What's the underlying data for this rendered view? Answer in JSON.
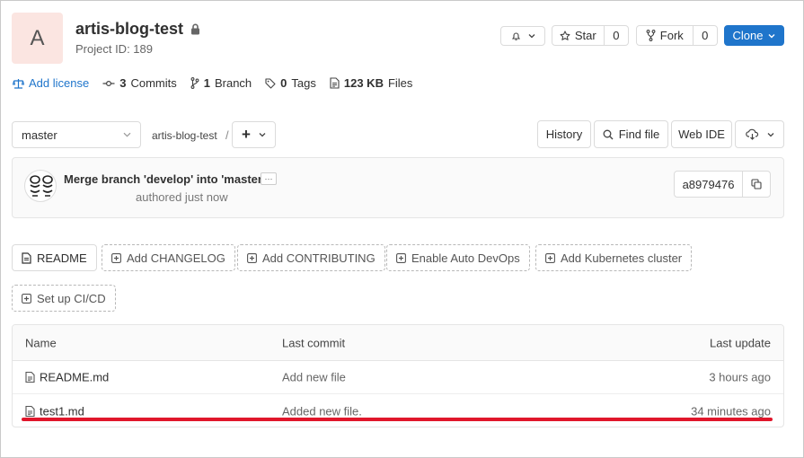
{
  "project": {
    "avatar_letter": "A",
    "name": "artis-blog-test",
    "id_label": "Project ID: 189"
  },
  "header_buttons": {
    "star_label": "Star",
    "star_count": "0",
    "fork_label": "Fork",
    "fork_count": "0",
    "clone_label": "Clone"
  },
  "stats": {
    "add_license": "Add license",
    "commits_count": "3",
    "commits_label": "Commits",
    "branch_count": "1",
    "branch_label": "Branch",
    "tags_count": "0",
    "tags_label": "Tags",
    "files_size": "123 KB",
    "files_label": "Files"
  },
  "repo_nav": {
    "branch": "master",
    "breadcrumb": "artis-blog-test",
    "separator": "/",
    "add_symbol": "+",
    "history": "History",
    "find_file": "Find file",
    "web_ide": "Web IDE"
  },
  "commit": {
    "title": "Merge branch 'develop' into 'master'",
    "authored": "authored just now",
    "more": "···",
    "sha": "a8979476"
  },
  "quick_actions": [
    "README",
    "Add CHANGELOG",
    "Add CONTRIBUTING",
    "Enable Auto DevOps",
    "Add Kubernetes cluster",
    "Set up CI/CD"
  ],
  "table": {
    "headers": [
      "Name",
      "Last commit",
      "Last update"
    ],
    "rows": [
      {
        "name": "README.md",
        "commit": "Add new file",
        "updated": "3 hours ago"
      },
      {
        "name": "test1.md",
        "commit": "Added new file.",
        "updated": "34 minutes ago"
      }
    ]
  },
  "colors": {
    "accent": "#1f75cb",
    "highlight_underline": "#e0162b",
    "avatar_bg": "#fbe5e1"
  }
}
